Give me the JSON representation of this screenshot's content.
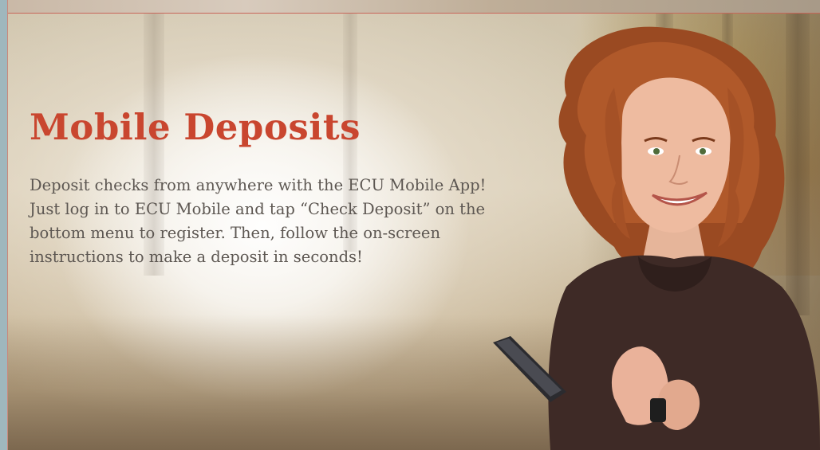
{
  "banner": {
    "title": "Mobile Deposits",
    "body": "Deposit checks from anywhere with the ECU Mobile App! Just log in to ECU Mobile and tap “Check Deposit” on the bottom menu to register. Then, follow the on-screen instructions to make a deposit in seconds!",
    "image": {
      "subject": "woman-holding-smartphone-photo"
    }
  },
  "colors": {
    "title": "#c9462f",
    "body_text": "#5d5752",
    "accent_border": "#c7665a"
  }
}
